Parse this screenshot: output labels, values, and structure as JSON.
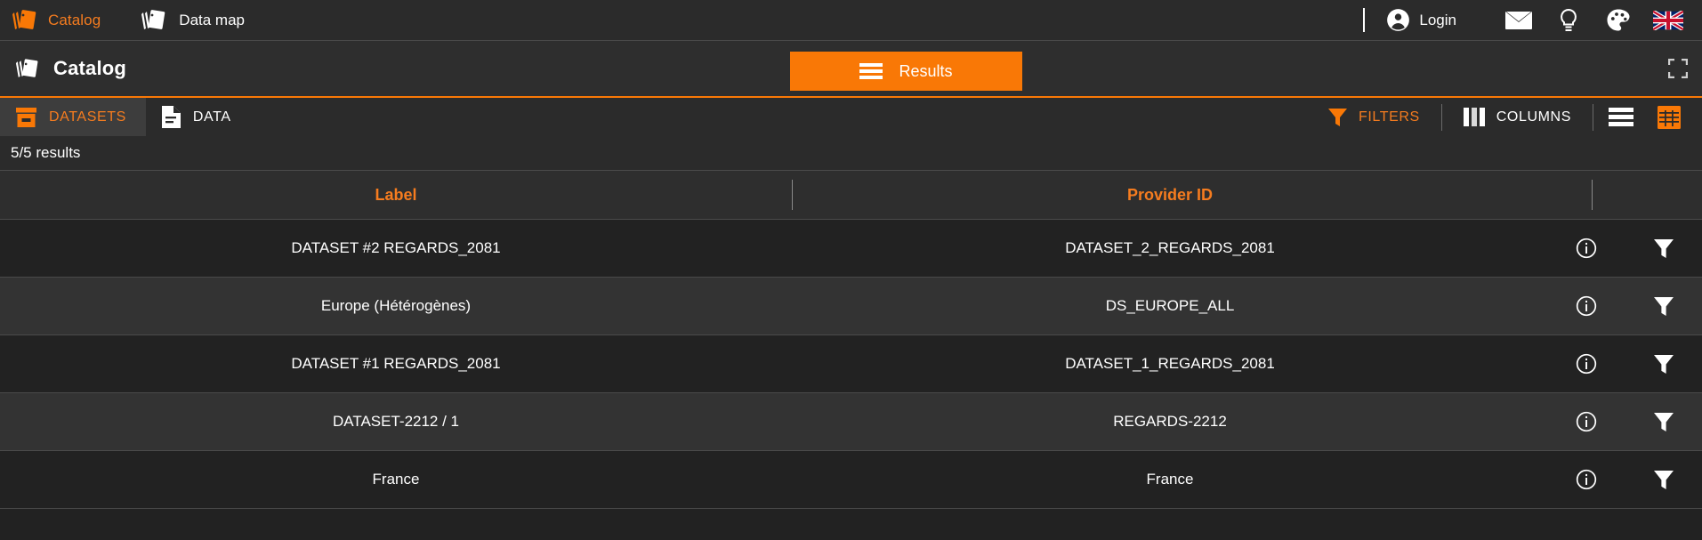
{
  "topbar": {
    "brand": {
      "label": "Catalog",
      "icon": "catalog-logo-icon"
    },
    "nav": [
      {
        "label": "Data map",
        "icon": "data-map-icon"
      }
    ],
    "login": {
      "label": "Login",
      "icon": "account-circle-icon"
    },
    "icons": [
      {
        "name": "mail-icon"
      },
      {
        "name": "lightbulb-icon"
      },
      {
        "name": "palette-icon"
      },
      {
        "name": "flag-uk-icon"
      }
    ]
  },
  "catalogbar": {
    "title": "Catalog",
    "results_button": {
      "label": "Results",
      "icon": "list-icon"
    },
    "fullscreen": {
      "name": "fullscreen-icon"
    }
  },
  "tabs": [
    {
      "label": "DATASETS",
      "icon": "archive-box-icon",
      "active": true
    },
    {
      "label": "DATA",
      "icon": "document-icon",
      "active": false
    }
  ],
  "toolbar": {
    "filters": {
      "label": "FILTERS",
      "icon": "filter-funnel-icon"
    },
    "columns": {
      "label": "COLUMNS",
      "icon": "view-columns-icon"
    },
    "list_view": {
      "name": "list-view-icon"
    },
    "grid_view": {
      "name": "grid-view-icon"
    }
  },
  "results": {
    "count_text": "5/5 results"
  },
  "table": {
    "columns": [
      "Label",
      "Provider ID"
    ],
    "rows": [
      {
        "label": "DATASET #2 REGARDS_2081",
        "provider_id": "DATASET_2_REGARDS_2081"
      },
      {
        "label": "Europe (Hétérogènes)",
        "provider_id": "DS_EUROPE_ALL"
      },
      {
        "label": "DATASET #1 REGARDS_2081",
        "provider_id": "DATASET_1_REGARDS_2081"
      },
      {
        "label": "DATASET-2212 / 1",
        "provider_id": "REGARDS-2212"
      },
      {
        "label": "France",
        "provider_id": "France"
      }
    ],
    "row_actions": [
      {
        "name": "info-icon"
      },
      {
        "name": "filter-funnel-icon"
      }
    ]
  },
  "colors": {
    "accent_orange": "#f97806",
    "accent_orange_text": "#f57c1f",
    "bg_dark": "#222222",
    "bg_row_alt": "#333333",
    "bg_bar": "#2b2b2b"
  }
}
